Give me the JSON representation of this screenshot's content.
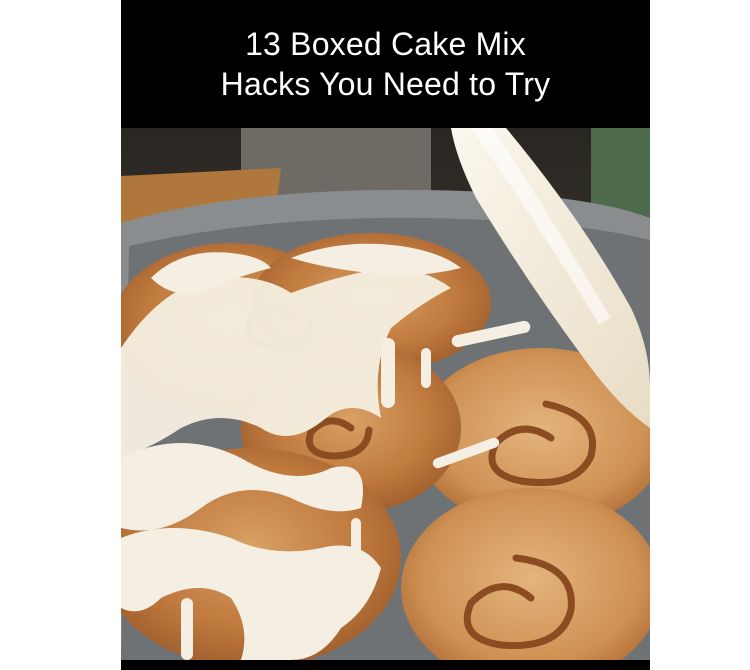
{
  "caption": {
    "line1": "13 Boxed Cake Mix",
    "line2": "Hacks You Need to Try"
  },
  "colors": {
    "background": "#ffffff",
    "frame": "#000000",
    "caption_text": "#ffffff",
    "pan": "#8a8d90",
    "dough": "#c98a4e",
    "icing": "#f4efe2"
  },
  "photo": {
    "subject": "cinnamon-rolls-in-pan",
    "icon": "icing-spatula-icon"
  }
}
